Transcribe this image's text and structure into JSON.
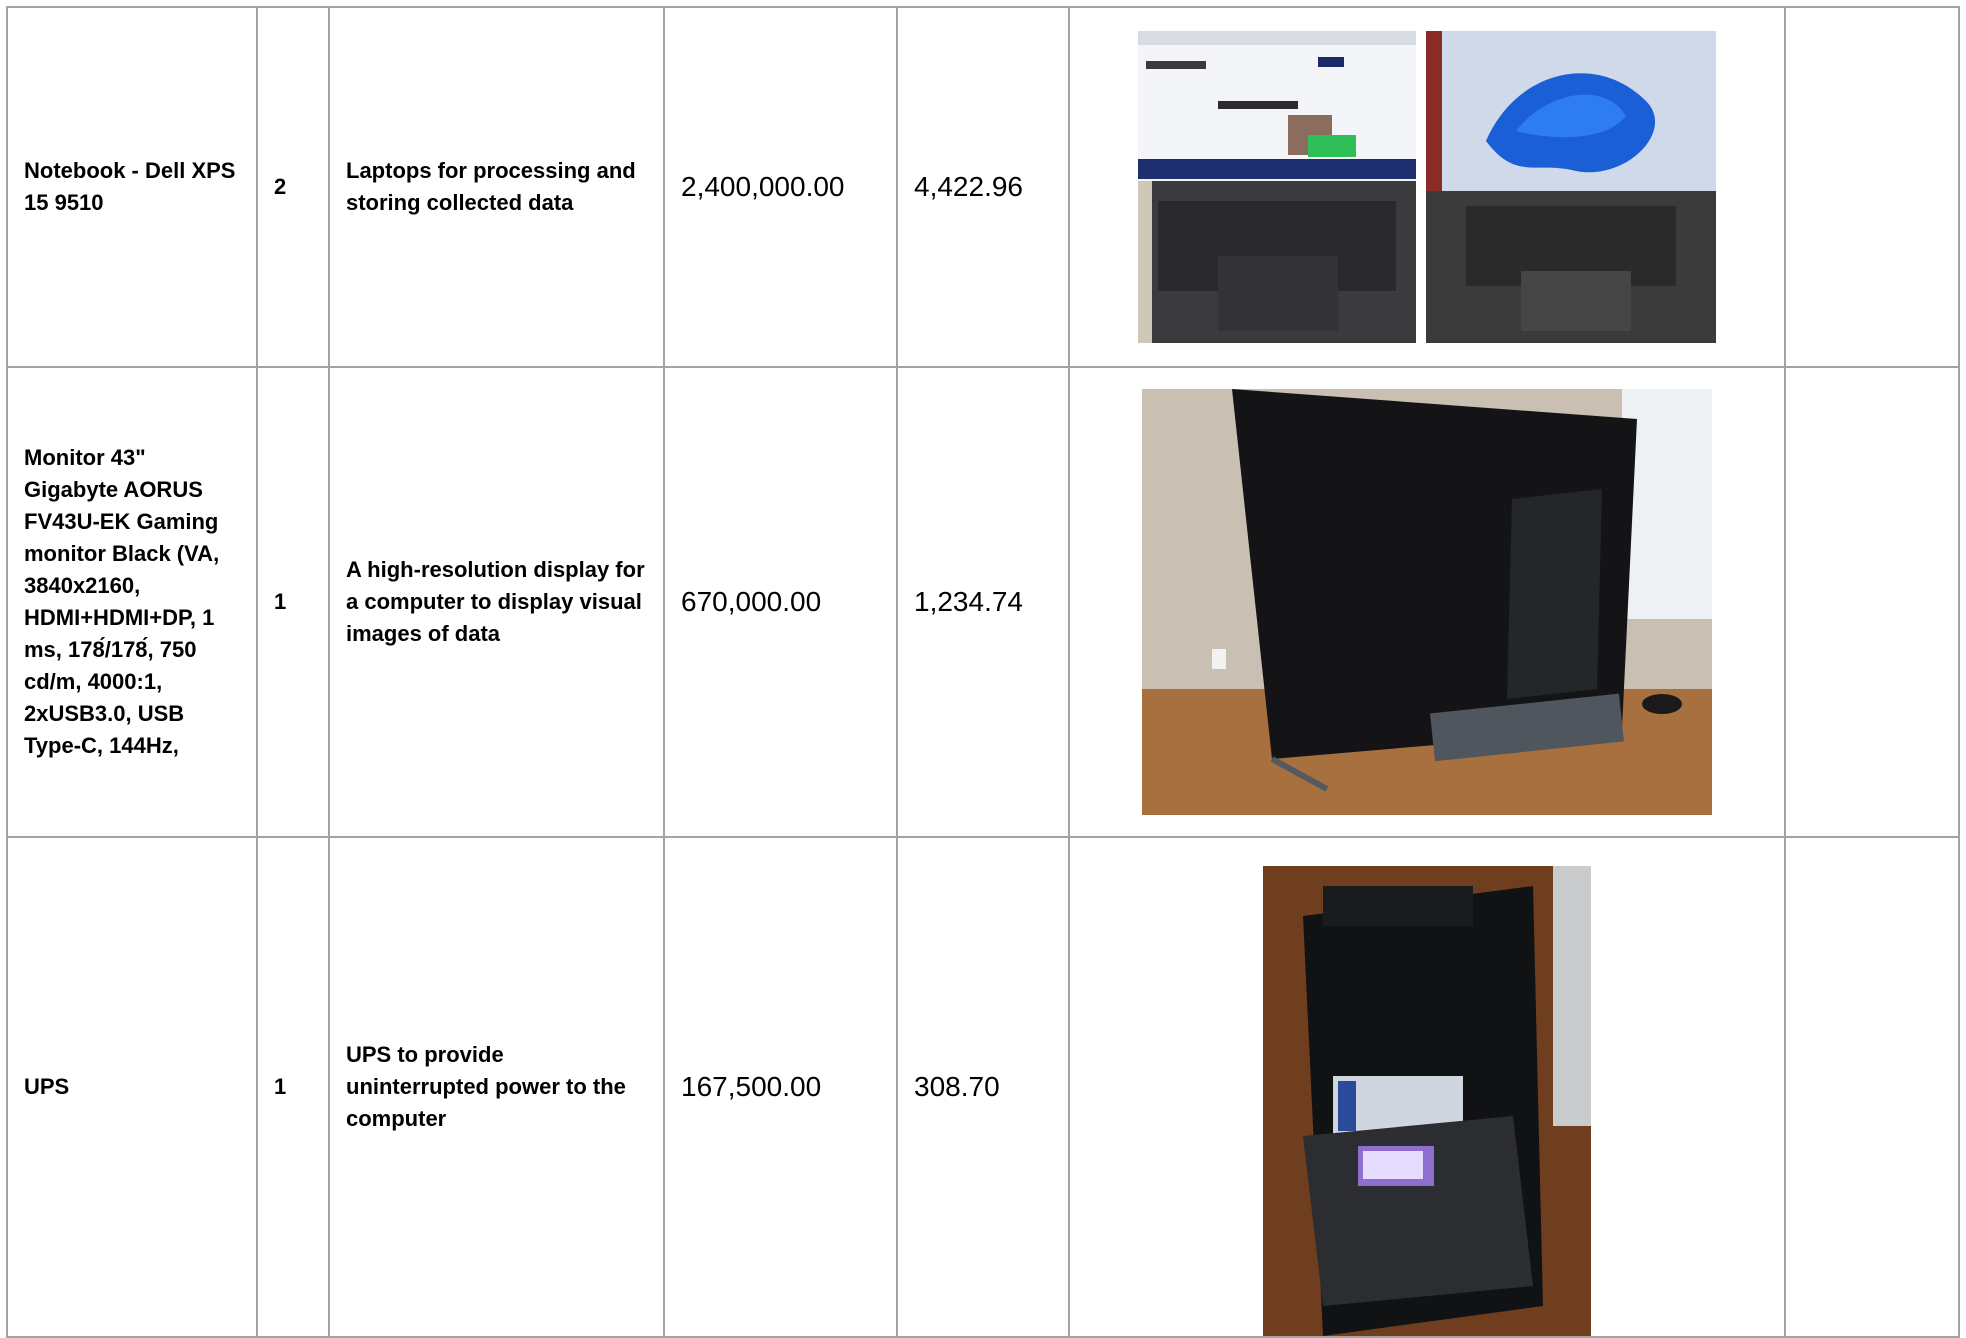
{
  "rows": [
    {
      "item": "Notebook - Dell XPS 15 9510",
      "qty": "2",
      "purpose": "Laptops for processing and storing collected data",
      "price_local": "2,400,000.00",
      "price_usd": "4,422.96",
      "photo_subjects": [
        "laptop-with-browser-photo",
        "laptop-with-windows-desktop-photo"
      ]
    },
    {
      "item": "Monitor 43\" Gigabyte AORUS FV43U-EK Gaming monitor Black (VA, 3840x2160, HDMI+HDMI+DP, 1 ms, 178́/178́, 750 cd/m, 4000:1, 2xUSB3.0, USB Type-C, 144Hz,",
      "qty": "1",
      "purpose": "A high-resolution display for a computer to display visual images of data",
      "price_local": "670,000.00",
      "price_usd": "1,234.74",
      "photo_subjects": [
        "monitor-on-desk-photo"
      ]
    },
    {
      "item": "UPS",
      "qty": "1",
      "purpose": "UPS to provide uninterrupted power to the computer",
      "price_local": "167,500.00",
      "price_usd": "308.70",
      "photo_subjects": [
        "ups-unit-photo"
      ]
    }
  ]
}
